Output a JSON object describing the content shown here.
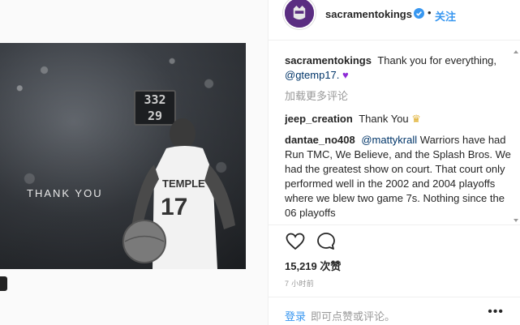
{
  "post": {
    "image_caption_text": "THANK YOU",
    "jersey_name": "TEMPLE",
    "jersey_number": "17",
    "scoreboard_top": "332",
    "scoreboard_bottom": "29"
  },
  "header": {
    "username": "sacramentokings",
    "dot": "•",
    "follow_label": "关注"
  },
  "comments": {
    "caption": {
      "username": "sacramentokings",
      "text": "Thank you for everything,",
      "mention": "@gtemp17.",
      "emoji": "♥"
    },
    "load_more": "加载更多评论",
    "items": [
      {
        "username": "jeep_creation",
        "text": "Thank You",
        "emoji": "♛"
      },
      {
        "username": "dantae_no408",
        "mention": "@mattykrall",
        "text": "Warriors have had Run TMC, We Believe, and the Splash Bros. We had the greatest show on court. That court only performed well in the 2002 and 2004 playoffs where we blew two game 7s. Nothing since the 06 playoffs"
      }
    ]
  },
  "actions": {
    "like_icon": "heart-outline-icon",
    "comment_icon": "speech-bubble-icon"
  },
  "likes": "15,219 次赞",
  "time_ago": "7 小时前",
  "footer": {
    "login_label": "登录",
    "prompt": "即可点赞或评论。",
    "more_label": "•••"
  },
  "colors": {
    "link_blue": "#3897f0",
    "kings_purple": "#5a2d81",
    "mention_blue": "#003569",
    "muted": "#999999"
  }
}
